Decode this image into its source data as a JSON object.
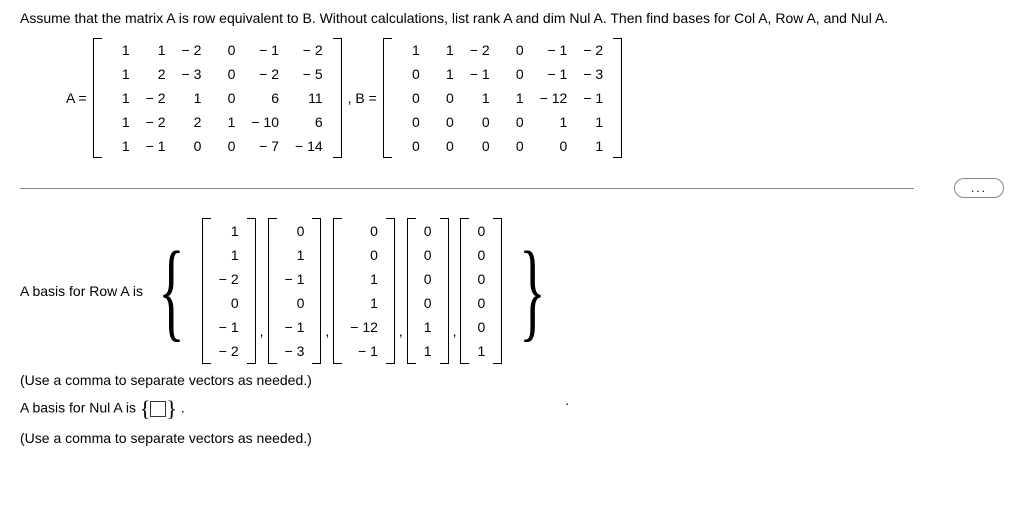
{
  "question": "Assume that the matrix A is row equivalent to B. Without calculations, list rank A and dim Nul A. Then find bases for Col A, Row A, and Nul A.",
  "labelA": "A =",
  "labelB": ", B =",
  "matA": [
    [
      "1",
      "1",
      "− 2",
      "0",
      "− 1",
      "− 2"
    ],
    [
      "1",
      "2",
      "− 3",
      "0",
      "− 2",
      "− 5"
    ],
    [
      "1",
      "− 2",
      "1",
      "0",
      "6",
      "11"
    ],
    [
      "1",
      "− 2",
      "2",
      "1",
      "− 10",
      "6"
    ],
    [
      "1",
      "− 1",
      "0",
      "0",
      "− 7",
      "− 14"
    ]
  ],
  "matB": [
    [
      "1",
      "1",
      "− 2",
      "0",
      "− 1",
      "− 2"
    ],
    [
      "0",
      "1",
      "− 1",
      "0",
      "− 1",
      "− 3"
    ],
    [
      "0",
      "0",
      "1",
      "1",
      "− 12",
      "− 1"
    ],
    [
      "0",
      "0",
      "0",
      "0",
      "1",
      "1"
    ],
    [
      "0",
      "0",
      "0",
      "0",
      "0",
      "1"
    ]
  ],
  "ellipsis": "...",
  "rowLabel": "A basis for Row A is",
  "vecs": [
    [
      "1",
      "1",
      "− 2",
      "0",
      "− 1",
      "− 2"
    ],
    [
      "0",
      "1",
      "− 1",
      "0",
      "− 1",
      "− 3"
    ],
    [
      "0",
      "0",
      "1",
      "1",
      "− 12",
      "− 1"
    ],
    [
      "0",
      "0",
      "0",
      "0",
      "1",
      "1"
    ],
    [
      "0",
      "0",
      "0",
      "0",
      "0",
      "1"
    ]
  ],
  "note1": "(Use a comma to separate vectors as needed.)",
  "nulLabel1": "A basis for Nul A is",
  "nulLabel2": ".",
  "note2": "(Use a comma to separate vectors as needed.)"
}
